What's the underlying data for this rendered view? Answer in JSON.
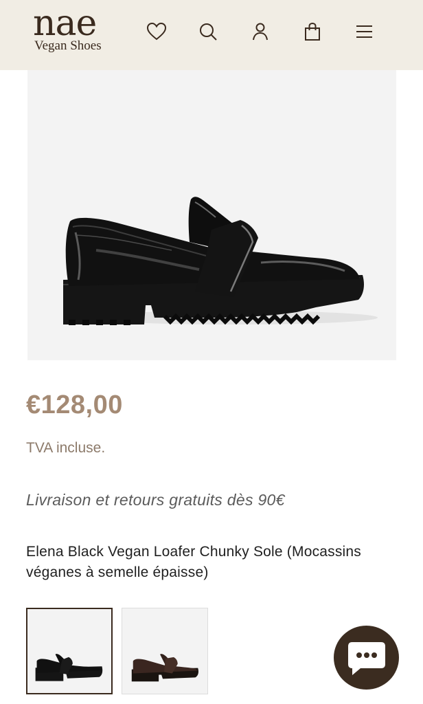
{
  "header": {
    "logo_word": "nae",
    "logo_sub": "Vegan Shoes",
    "icons": [
      "heart-icon",
      "search-icon",
      "user-icon",
      "shopping-bag-icon",
      "menu-icon"
    ]
  },
  "product": {
    "price": "€128,00",
    "tax_note": "TVA incluse.",
    "shipping_note": "Livraison et retours gratuits dès 90€",
    "title": "Elena Black Vegan Loafer Chunky Sole (Mocassins véganes à semelle épaisse)",
    "thumbnails": [
      "black",
      "brown"
    ]
  },
  "colors": {
    "header_bg": "#f1ede4",
    "brand_dark": "#3a2a1e",
    "price": "#a48a74",
    "chat_button": "#3b2c20"
  }
}
